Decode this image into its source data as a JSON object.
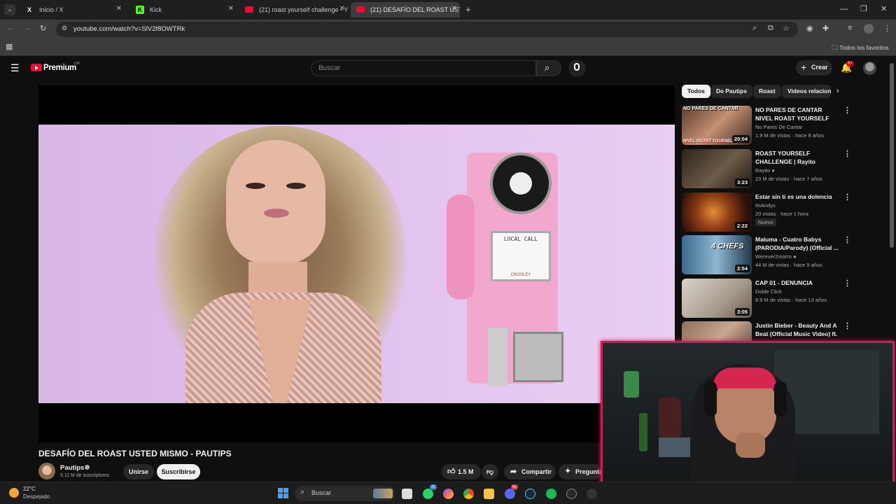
{
  "browser": {
    "tabs": [
      {
        "label": "Inicio / X",
        "icon": "x-logo-icon",
        "active": false
      },
      {
        "label": "Kick",
        "icon": "kick-logo-icon",
        "active": false
      },
      {
        "label": "(21) roast yourself challenge - Y",
        "icon": "youtube-icon",
        "active": false
      },
      {
        "label": "(21) DESAFÍO DEL ROAST USTE",
        "icon": "youtube-icon",
        "active": true
      }
    ],
    "url": "youtube.com/watch?v=SlV2f8OWTRk",
    "bookmarks_label": "Todos los favoritos"
  },
  "header": {
    "logo_text": "Premium",
    "region": "CR",
    "search_placeholder": "Buscar",
    "create_label": "Crear",
    "notification_count": "9+"
  },
  "chips": [
    "Todos",
    "De Pautips",
    "Roast",
    "Videos relacion"
  ],
  "video": {
    "title": "DESAFÍO DEL ROAST USTED MISMO - PAUTIPS",
    "channel": "Pautips",
    "subscribers": "9.11 M de suscriptores",
    "join_label": "Unirse",
    "subscribe_label": "Suscribirse",
    "likes": "1.5 M",
    "share_label": "Compartir",
    "ask_label": "Pregunta",
    "phone_sign": "LOCAL CALL",
    "phone_brand": "CROSLEY"
  },
  "recommendations": [
    {
      "title": "NO PARES DE CANTAR NIVEL ROAST YOURSELF CHALLENGE",
      "channel": "No Pares De Cantar",
      "meta": "1.9 M de vistas · hace 8 años",
      "duration": "20:04",
      "verified": false,
      "badge": ""
    },
    {
      "title": "ROAST YOURSELF CHALLENGE | Rayito",
      "channel": "Rayito",
      "meta": "23 M de vistas · hace 7 años",
      "duration": "3:23",
      "verified": true,
      "badge": ""
    },
    {
      "title": "Estar sin ti es una dolencia",
      "channel": "ItsAndys",
      "meta": "20 vistas · hace 1 hora",
      "duration": "2:22",
      "verified": false,
      "badge": "Nuevo"
    },
    {
      "title": "Maluma - Cuatro Babys (PARODIA/Parody) (Official ...",
      "channel": "Werever2morro",
      "meta": "44 M de vistas · hace 9 años",
      "duration": "2:54",
      "verified": true,
      "badge": ""
    },
    {
      "title": "CAP 01 - DENUNCIA",
      "channel": "Doble Click",
      "meta": "6.9 M de vistas · hace 13 años",
      "duration": "3:05",
      "verified": false,
      "badge": ""
    },
    {
      "title": "Justin Bieber - Beauty And A Beat (Official Music Video) ft. ...",
      "channel": "",
      "meta": "",
      "duration": "",
      "verified": false,
      "badge": ""
    }
  ],
  "thumb_texts": {
    "first_top": "NO PARES DE CANTAR",
    "first_bottom": "NIVEL ROAST YOURSELF",
    "fourth": "4 CHEFS"
  },
  "taskbar": {
    "temperature": "22°C",
    "weather": "Despejado",
    "search_placeholder": "Buscar",
    "whatsapp_badge": "31",
    "discord_badge": "9+"
  },
  "colors": {
    "youtube_red": "#ff0033",
    "cam_border": "#c61f57",
    "background": "#0f0f0f"
  }
}
